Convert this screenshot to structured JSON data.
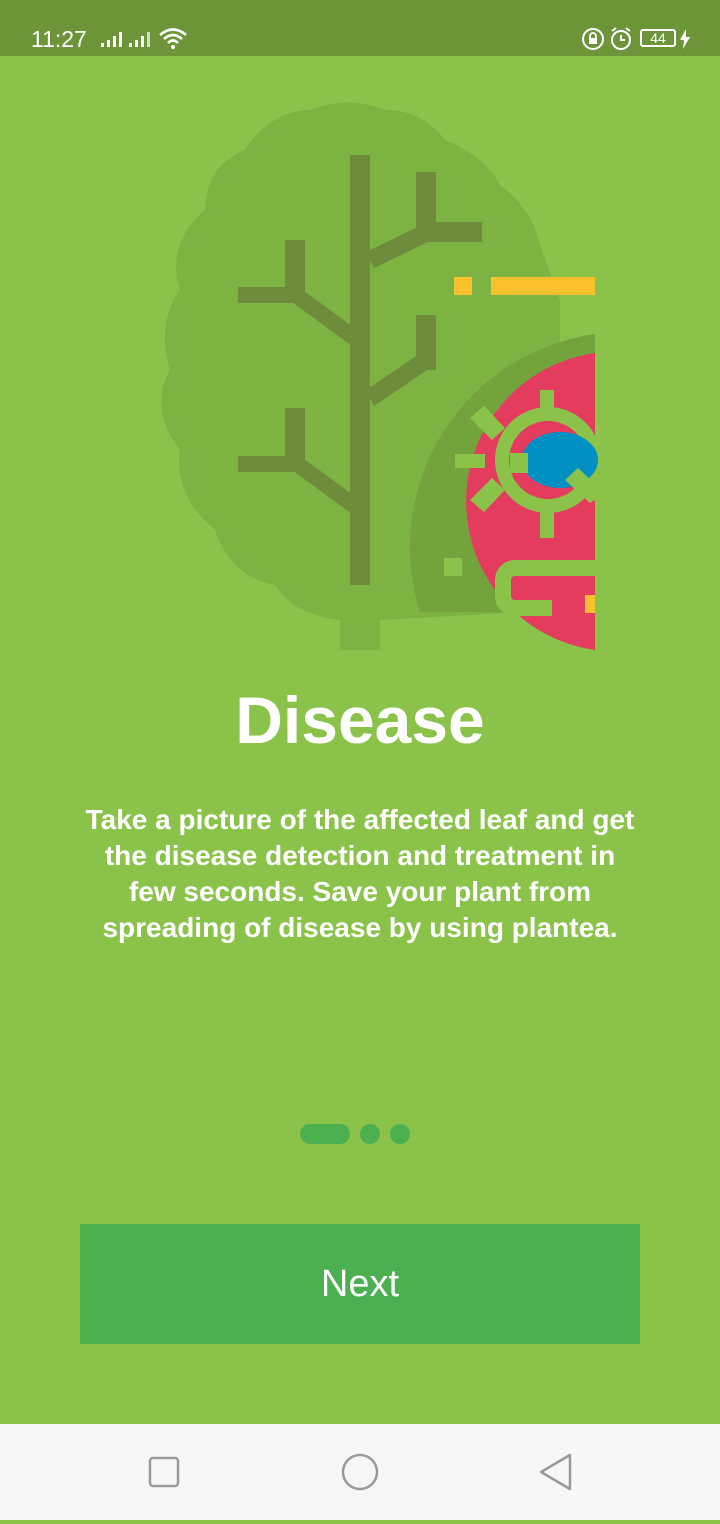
{
  "status_bar": {
    "time": "11:27",
    "battery": "44",
    "icons": [
      "signal-icon",
      "signal-icon",
      "wifi-icon",
      "lock-rotation-icon",
      "alarm-icon",
      "battery-icon",
      "charging-icon"
    ]
  },
  "onboarding": {
    "illustration": "leaf-disease-illustration",
    "title": "Disease",
    "description": "Take a picture of the affected leaf and get the disease detection and treatment in few seconds. Save your plant  from spreading of disease by using plantea.",
    "page_indicator": {
      "total": 3,
      "current": 1
    },
    "next_label": "Next"
  },
  "navigation_bar": {
    "buttons": [
      "recent-apps",
      "home",
      "back"
    ]
  },
  "colors": {
    "background": "#8bc34a",
    "status_bar": "#6c953a",
    "accent": "#4caf50",
    "leaf_light": "#7cb342",
    "leaf_dark": "#6e8c3c",
    "disease_red": "#e33c5f",
    "bug_blue": "#0091c2",
    "yellow": "#fbc02d"
  }
}
